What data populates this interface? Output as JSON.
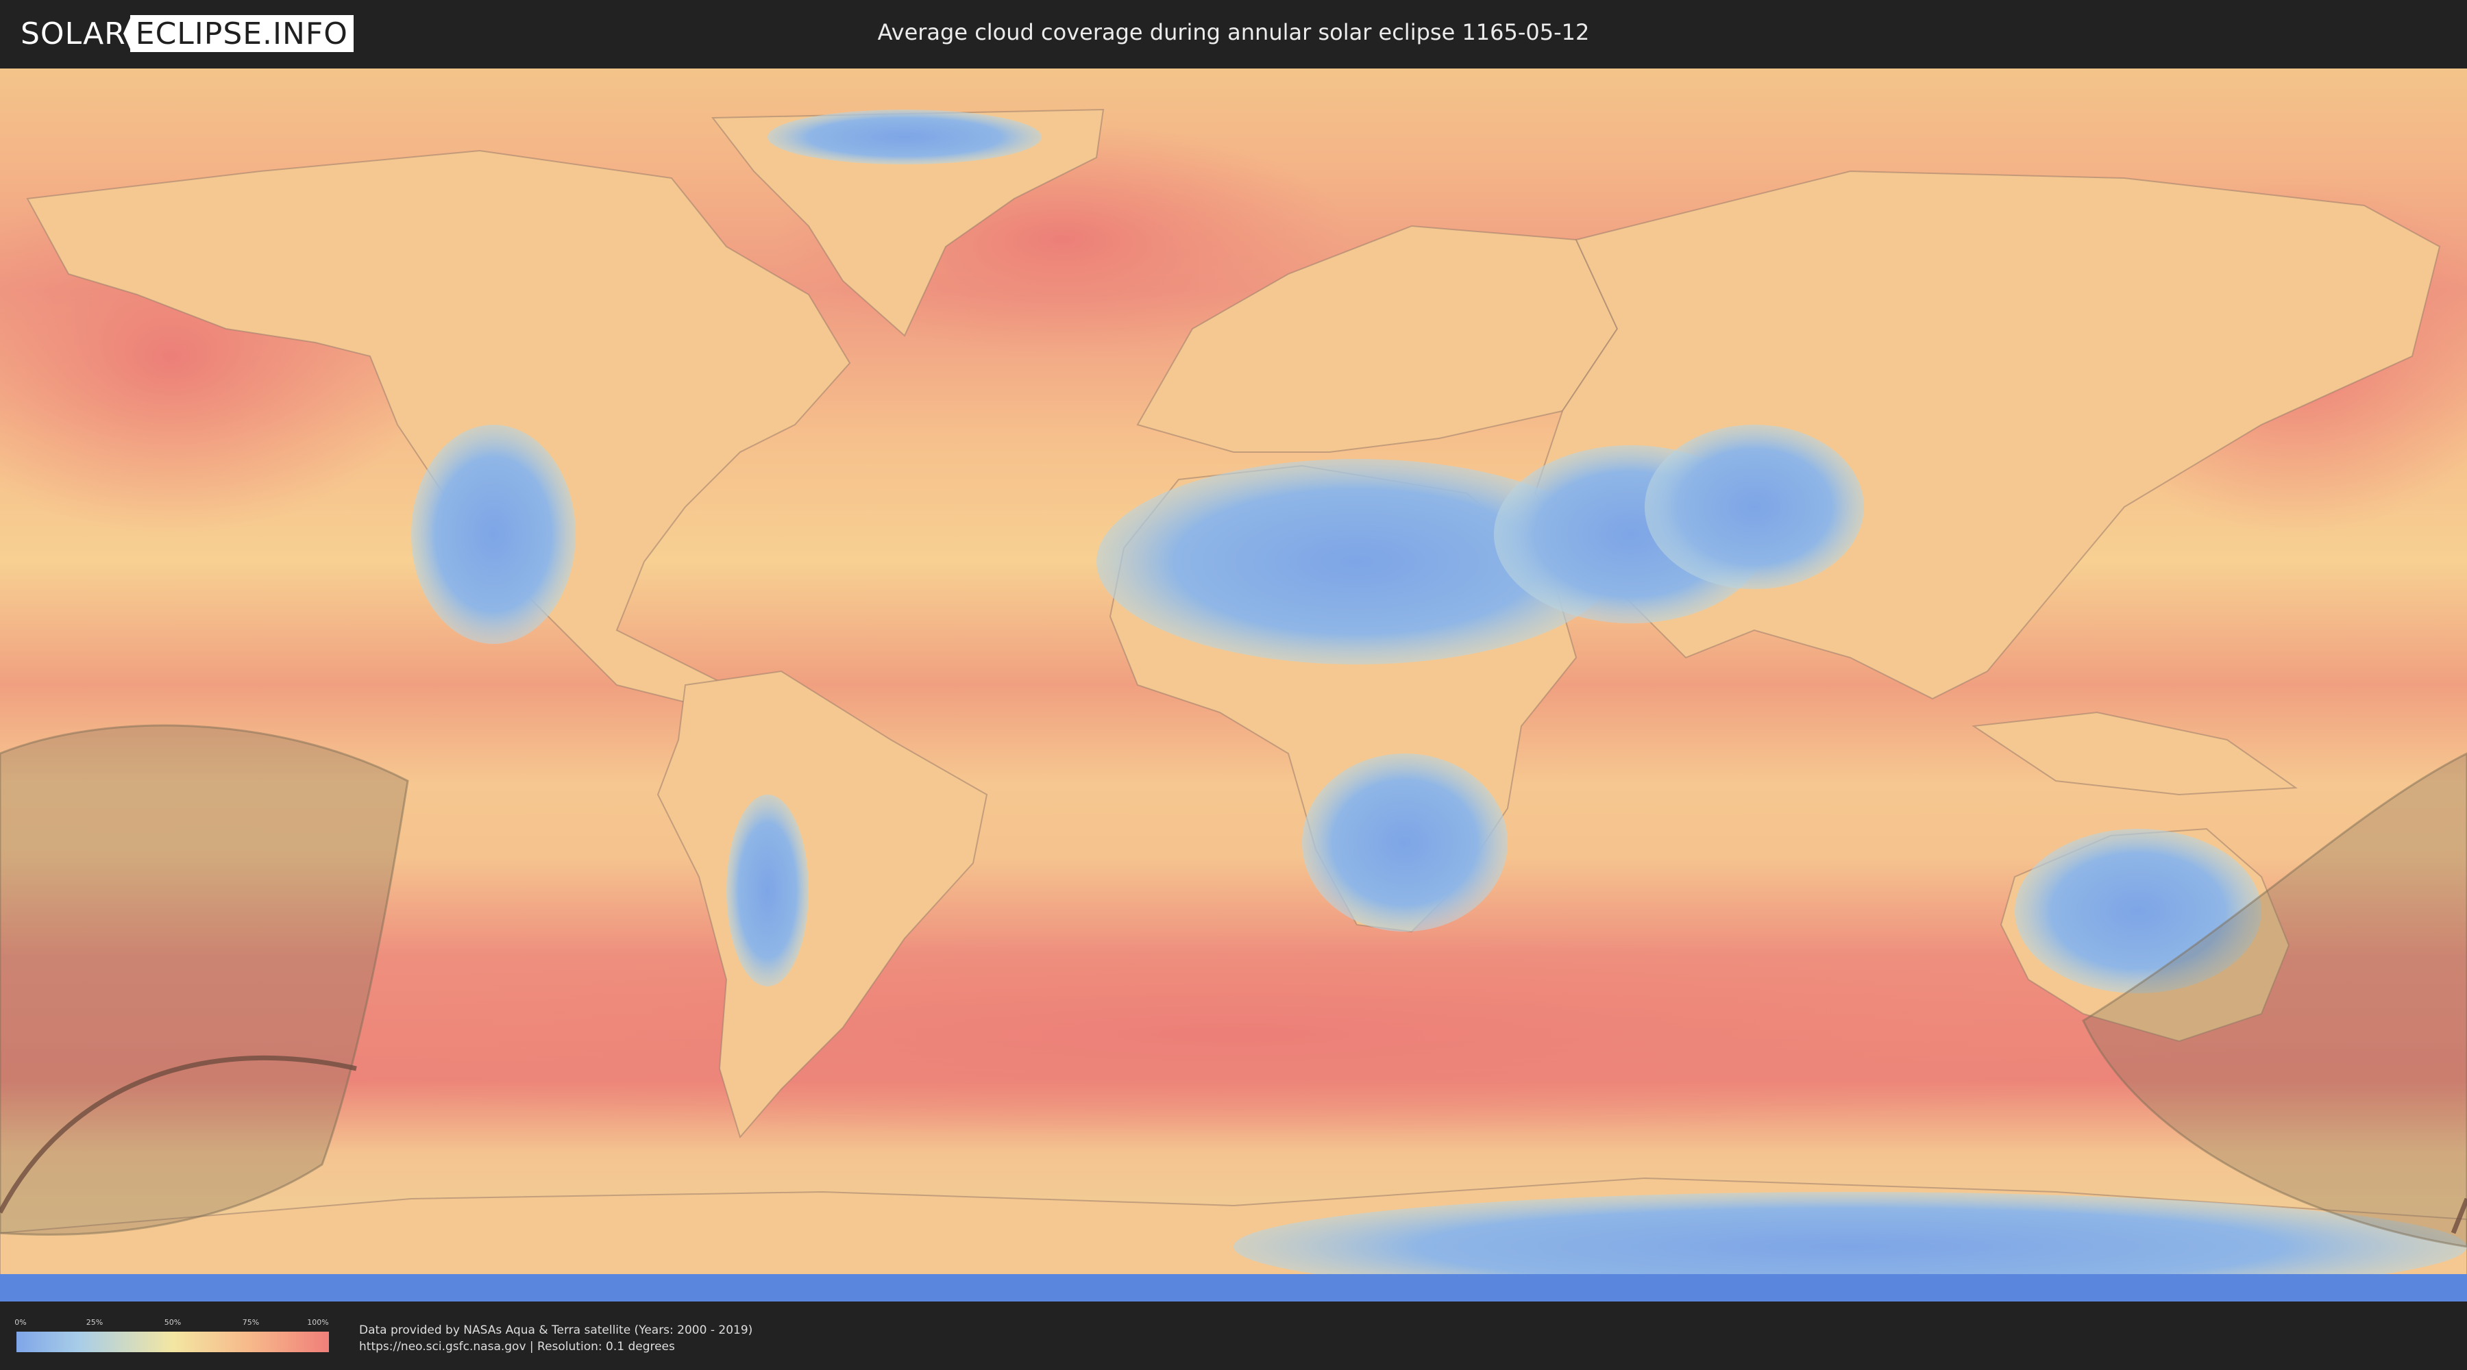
{
  "header": {
    "logo_left": "SOLAR",
    "logo_right": "ECLIPSE.INFO",
    "title": "Average cloud coverage during annular solar eclipse 1165-05-12"
  },
  "legend": {
    "ticks": [
      "0%",
      "25%",
      "50%",
      "75%",
      "100%"
    ],
    "colors": [
      "#7fa6e8",
      "#a8cde8",
      "#f3e6a2",
      "#f7b88a",
      "#f07f7a"
    ]
  },
  "credits": {
    "line1": "Data provided by NASAs Aqua & Terra satellite (Years: 2000 - 2019)",
    "line2": "https://neo.sci.gsfc.nasa.gov | Resolution: 0.1 degrees"
  },
  "map": {
    "ocean_cloudy_color": "#ee8a7c",
    "clear_color": "#86aee6",
    "mid_color": "#f5d394",
    "eclipse_shadow_color": "#8a7a5a"
  }
}
